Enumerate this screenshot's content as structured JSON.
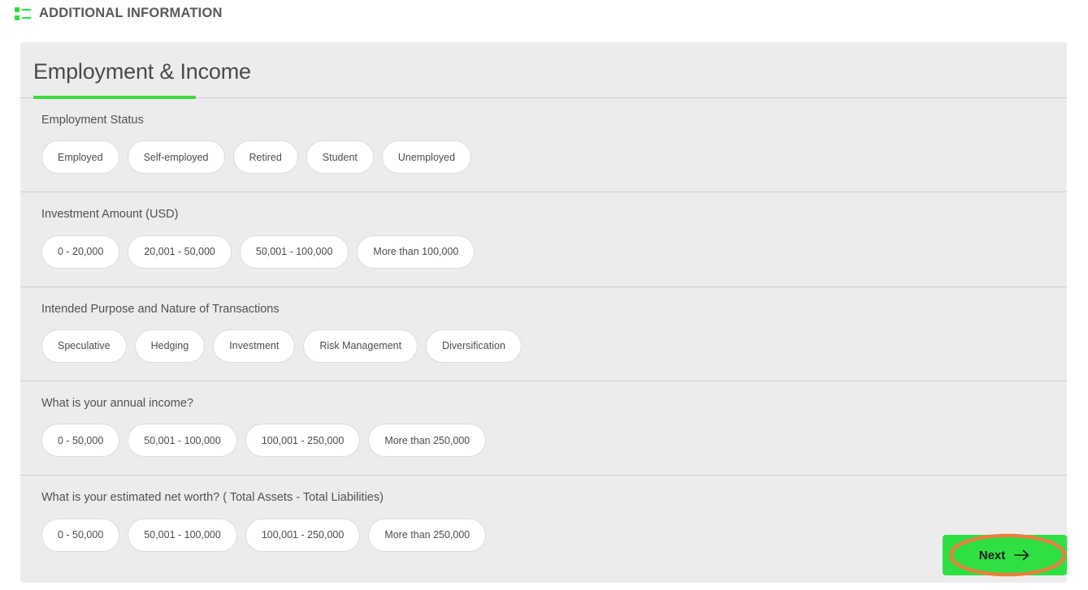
{
  "header": {
    "icon": "list-icon",
    "title": "ADDITIONAL INFORMATION",
    "accent_color": "#2fe03f",
    "text_color": "#58595b"
  },
  "card": {
    "title": "Employment & Income",
    "accent_color": "#3ddb3d",
    "background": "#ececec",
    "questions": [
      {
        "label": "Employment Status",
        "options": [
          "Employed",
          "Self-employed",
          "Retired",
          "Student",
          "Unemployed"
        ]
      },
      {
        "label": "Investment Amount (USD)",
        "options": [
          "0 - 20,000",
          "20,001 - 50,000",
          "50,001 - 100,000",
          "More than 100,000"
        ]
      },
      {
        "label": "Intended Purpose and Nature of Transactions",
        "options": [
          "Speculative",
          "Hedging",
          "Investment",
          "Risk Management",
          "Diversification"
        ]
      },
      {
        "label": "What is your annual income?",
        "options": [
          "0 - 50,000",
          "50,001 - 100,000",
          "100,001 - 250,000",
          "More than 250,000"
        ]
      },
      {
        "label": "What is your estimated net worth? ( Total Assets - Total Liabilities)",
        "options": [
          "0 - 50,000",
          "50,001 - 100,000",
          "100,001 - 250,000",
          "More than 250,000"
        ]
      }
    ]
  },
  "footer": {
    "next_label": "Next",
    "next_icon": "arrow-right-icon",
    "next_background": "#2fe044"
  },
  "annotation": {
    "shape": "ellipse-highlight",
    "color": "#e8803c",
    "target": "next-button"
  }
}
